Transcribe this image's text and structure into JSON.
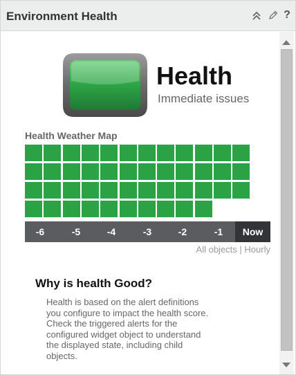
{
  "widget": {
    "title": "Environment Health",
    "help_icon": "?",
    "icons": [
      "collapse-icon",
      "edit-icon",
      "help-icon"
    ]
  },
  "health": {
    "title": "Health",
    "subtitle": "Immediate issues",
    "badge_color": "#2ba345"
  },
  "weather_map": {
    "label": "Health Weather Map",
    "rows": [
      12,
      12,
      12,
      10
    ],
    "cell_color": "#2ba345",
    "timeline": [
      "-6",
      "-5",
      "-4",
      "-3",
      "-2",
      "-1",
      "Now"
    ],
    "scope_all": "All objects",
    "scope_sep": "|",
    "scope_period": "Hourly"
  },
  "why": {
    "title": "Why is health Good?",
    "lines": [
      "Health is based on the alert definitions",
      "you configure to impact the health score.",
      "Check the triggered alerts for the",
      "configured widget object to understand",
      "the displayed state, including child",
      "objects."
    ]
  }
}
